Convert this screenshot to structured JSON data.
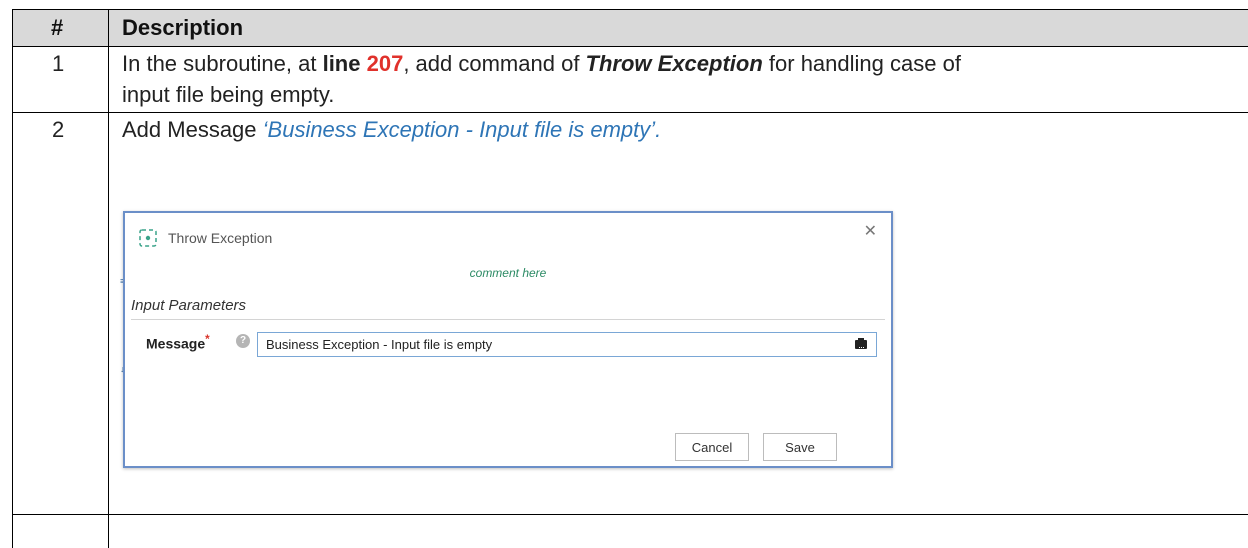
{
  "table": {
    "header": {
      "num": "#",
      "description": "Description"
    },
    "rows": [
      {
        "num": "1",
        "line1": {
          "part1": "In the subroutine, at ",
          "line_word": "line",
          "line_number": "207",
          "part2": ", add command of ",
          "command": "Throw Exception",
          "part3": " for handling case of"
        },
        "line2": "input file being empty."
      },
      {
        "num": "2",
        "prefix": "Add Message ",
        "message": "‘Business Exception - Input file is empty’."
      },
      {
        "num": "",
        "text": ""
      }
    ]
  },
  "dialog": {
    "title": "Throw Exception",
    "close_icon": "close-icon",
    "comment": "comment here",
    "section": "Input Parameters",
    "field_label": "Message",
    "required_mark": "*",
    "help_icon": "question-icon",
    "message_value": "Business Exception - Input file is empty",
    "variable_icon": "variable-picker-icon",
    "cancel_label": "Cancel",
    "save_label": "Save",
    "colors": {
      "border": "#6b8fc8",
      "comment": "#2b8a64",
      "required": "#d9342b"
    }
  },
  "colors": {
    "header_bg": "#d9d9d9",
    "line_number": "#e0312b",
    "message": "#2e75b6"
  }
}
